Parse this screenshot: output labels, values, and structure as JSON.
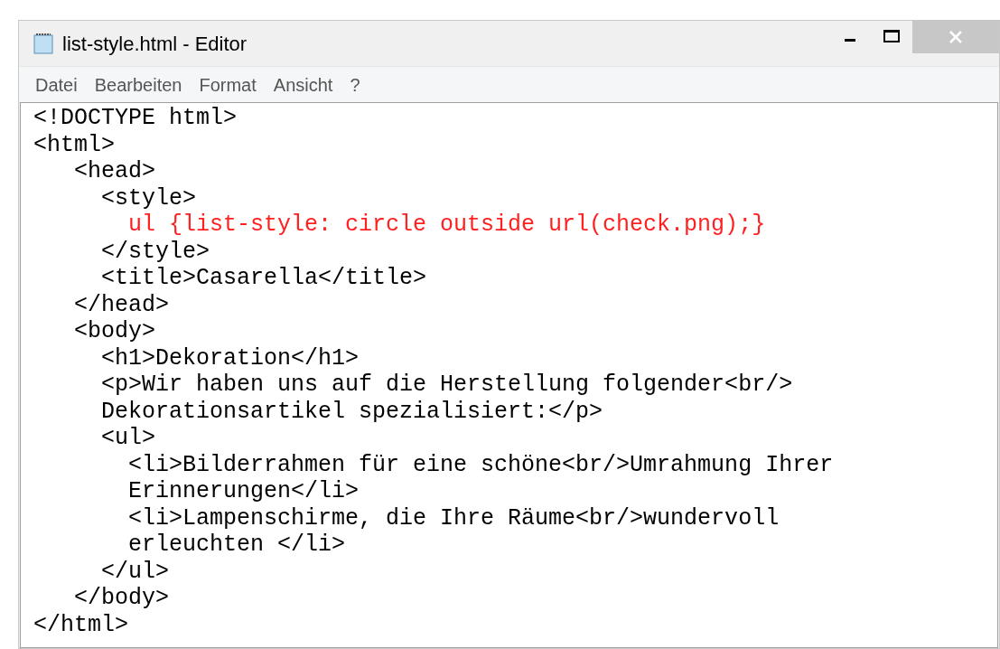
{
  "window": {
    "title": "list-style.html - Editor"
  },
  "menu": [
    {
      "label": "Datei"
    },
    {
      "label": "Bearbeiten"
    },
    {
      "label": "Format"
    },
    {
      "label": "Ansicht"
    },
    {
      "label": "?"
    }
  ],
  "editor": {
    "lines": [
      {
        "text": "<!DOCTYPE html>",
        "color": "#000000"
      },
      {
        "text": "<html>",
        "color": "#000000"
      },
      {
        "text": "   <head>",
        "color": "#000000"
      },
      {
        "text": "     <style>",
        "color": "#000000"
      },
      {
        "text": "       ul {list-style: circle outside url(check.png);}",
        "color": "#ff2020"
      },
      {
        "text": "     </style>",
        "color": "#000000"
      },
      {
        "text": "     <title>Casarella</title>",
        "color": "#000000"
      },
      {
        "text": "   </head>",
        "color": "#000000"
      },
      {
        "text": "   <body>",
        "color": "#000000"
      },
      {
        "text": "     <h1>Dekoration</h1>",
        "color": "#000000"
      },
      {
        "text": "     <p>Wir haben uns auf die Herstellung folgender<br/>",
        "color": "#000000"
      },
      {
        "text": "     Dekorationsartikel spezialisiert:</p>",
        "color": "#000000"
      },
      {
        "text": "     <ul>",
        "color": "#000000"
      },
      {
        "text": "       <li>Bilderrahmen für eine schöne<br/>Umrahmung Ihrer",
        "color": "#000000"
      },
      {
        "text": "       Erinnerungen</li>",
        "color": "#000000"
      },
      {
        "text": "       <li>Lampenschirme, die Ihre Räume<br/>wundervoll",
        "color": "#000000"
      },
      {
        "text": "       erleuchten </li>",
        "color": "#000000"
      },
      {
        "text": "     </ul>",
        "color": "#000000"
      },
      {
        "text": "   </body>",
        "color": "#000000"
      },
      {
        "text": "</html>",
        "color": "#000000"
      }
    ]
  }
}
